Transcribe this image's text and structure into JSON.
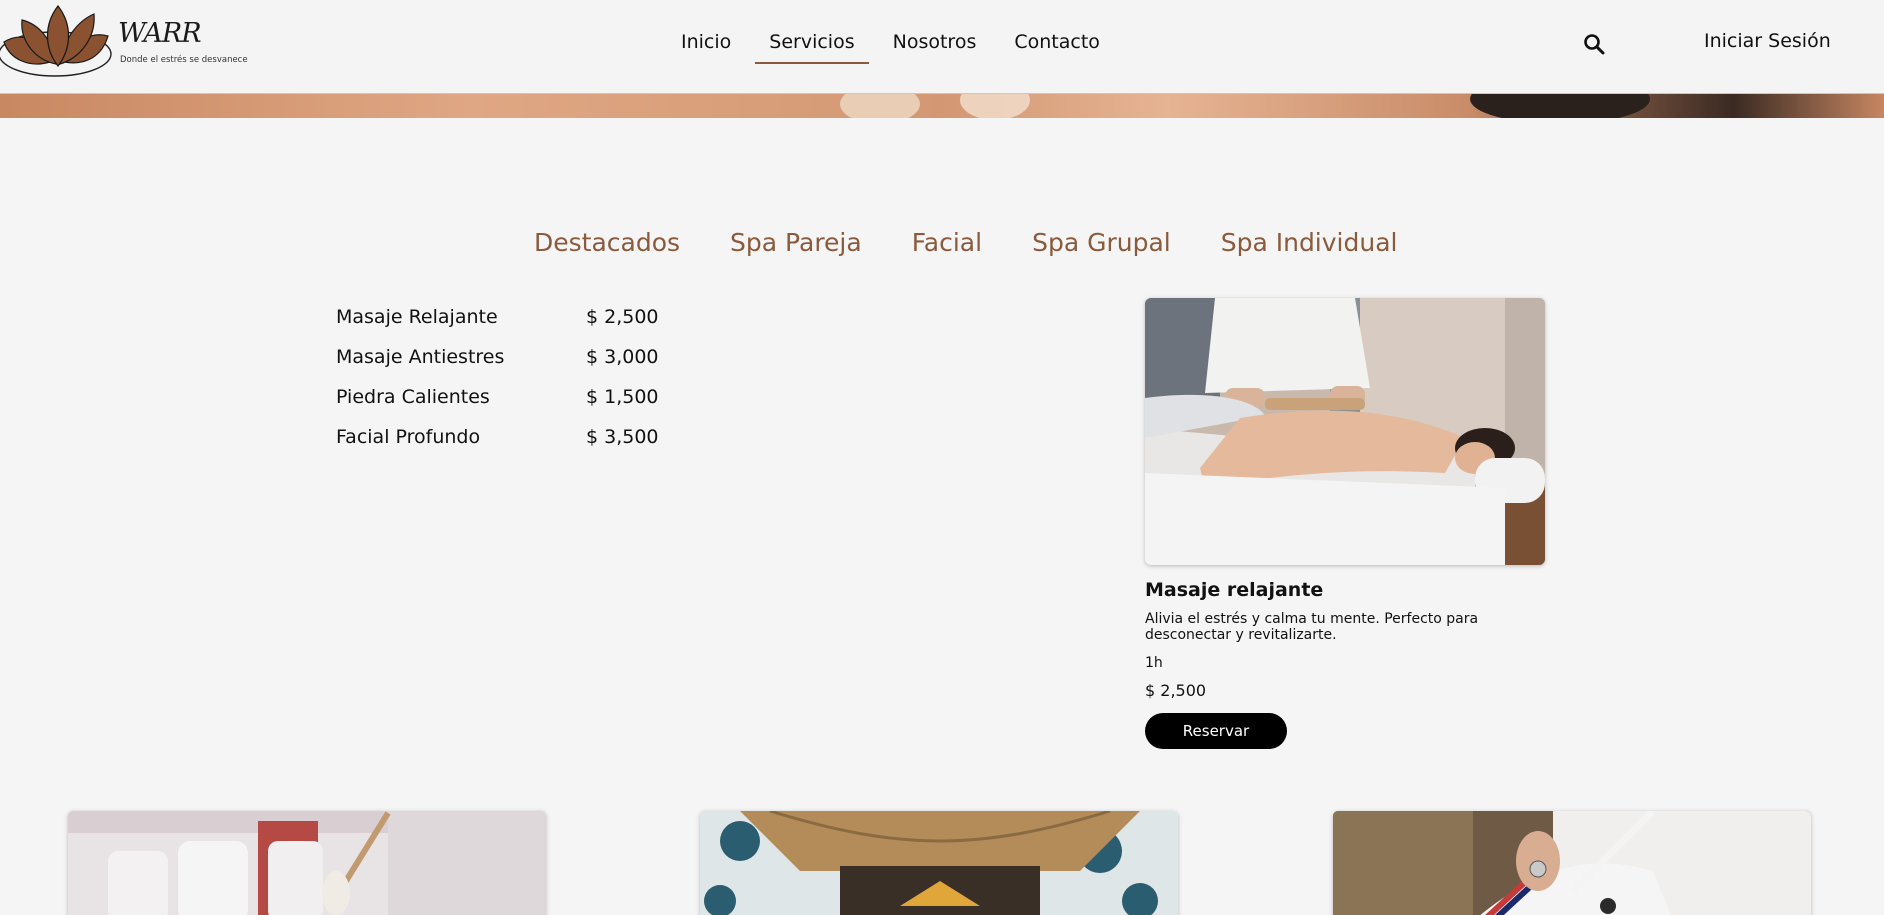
{
  "header": {
    "brand": "WARR",
    "tagline": "Donde el estrés se desvanece",
    "nav": [
      "Inicio",
      "Servicios",
      "Nosotros",
      "Contacto"
    ],
    "active_nav": "Servicios",
    "login": "Iniciar Sesión"
  },
  "tabs": [
    "Destacados",
    "Spa Pareja",
    "Facial",
    "Spa Grupal",
    "Spa Individual"
  ],
  "price_list": [
    {
      "name": "Masaje Relajante",
      "price": "$ 2,500"
    },
    {
      "name": "Masaje Antiestres",
      "price": "$ 3,000"
    },
    {
      "name": "Piedra Calientes",
      "price": "$ 1,500"
    },
    {
      "name": "Facial Profundo",
      "price": "$ 3,500"
    }
  ],
  "feature": {
    "title": "Masaje relajante",
    "description": "Alivia el estrés y calma tu mente. Perfecto para desconectar y revitalizarte.",
    "duration": "1h",
    "price": "$ 2,500",
    "button": "Reservar"
  },
  "colors": {
    "accent": "#8a5a3c",
    "logo_fill": "#8b5232",
    "background": "#f5f5f5",
    "button": "#000000"
  },
  "icons": {
    "search": "search-icon",
    "logo": "lotus-logo-icon"
  }
}
